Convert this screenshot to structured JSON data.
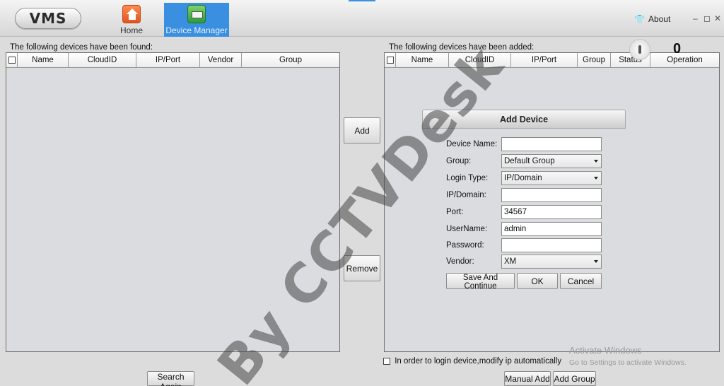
{
  "app": {
    "logo": "VMS"
  },
  "nav": {
    "home_label": "Home",
    "device_manager_label": "Device Manager"
  },
  "window": {
    "about_label": "About",
    "minimize_glyph": "–",
    "restore_glyph": "◻",
    "close_glyph": "✕"
  },
  "found": {
    "label": "The following devices have been found:",
    "columns": [
      "Name",
      "CloudID",
      "IP/Port",
      "Vendor",
      "Group"
    ]
  },
  "added": {
    "label": "The following devices have been added:",
    "columns": [
      "Name",
      "CloudID",
      "IP/Port",
      "Group",
      "Status",
      "Operation"
    ]
  },
  "counter": {
    "value": "0"
  },
  "buttons": {
    "add": "Add",
    "remove": "Remove",
    "search_again": "Search Again",
    "manual_add": "Manual Add",
    "add_group": "Add Group"
  },
  "auto_ip": {
    "label": "In order to login device,modify ip automatically",
    "checked": false
  },
  "dialog": {
    "title": "Add Device",
    "fields": {
      "device_name": {
        "label": "Device Name:",
        "value": ""
      },
      "group": {
        "label": "Group:",
        "value": "Default Group"
      },
      "login_type": {
        "label": "Login Type:",
        "value": "IP/Domain"
      },
      "ip_domain": {
        "label": "IP/Domain:",
        "value": ""
      },
      "port": {
        "label": "Port:",
        "value": "34567"
      },
      "username": {
        "label": "UserName:",
        "value": "admin"
      },
      "password": {
        "label": "Password:",
        "value": ""
      },
      "vendor": {
        "label": "Vendor:",
        "value": "XM"
      }
    },
    "buttons": {
      "save_continue": "Save And Continue",
      "ok": "OK",
      "cancel": "Cancel"
    }
  },
  "watermark": "By CCTVDesk",
  "activation": {
    "line1": "Activate Windows",
    "line2": "Go to Settings to activate Windows."
  },
  "colors": {
    "accent": "#3a8fe0",
    "home_icon": "#e0561e",
    "dm_icon": "#2c9a3a"
  }
}
